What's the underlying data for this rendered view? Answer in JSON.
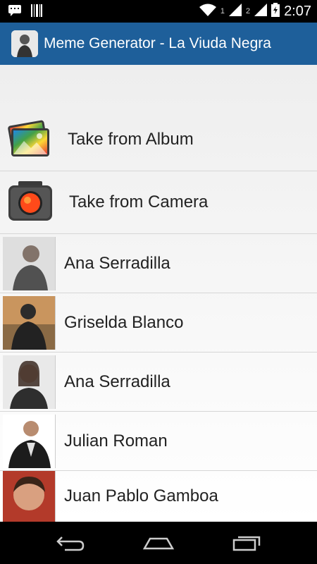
{
  "status_bar": {
    "sim1": "1",
    "sim2": "2",
    "time": "2:07",
    "icons": [
      "chat-notification-icon",
      "barcode-icon",
      "wifi-icon",
      "signal-icon",
      "signal-icon",
      "battery-icon"
    ]
  },
  "action_bar": {
    "title": "Meme Generator - La Viuda Negra",
    "color": "#1e5f9a"
  },
  "list": {
    "album_label": "Take from Album",
    "camera_label": "Take from Camera",
    "items": [
      {
        "label": "Ana Serradilla"
      },
      {
        "label": "Griselda Blanco"
      },
      {
        "label": "Ana Serradilla"
      },
      {
        "label": "Julian Roman"
      },
      {
        "label": "Juan Pablo Gamboa"
      }
    ]
  }
}
